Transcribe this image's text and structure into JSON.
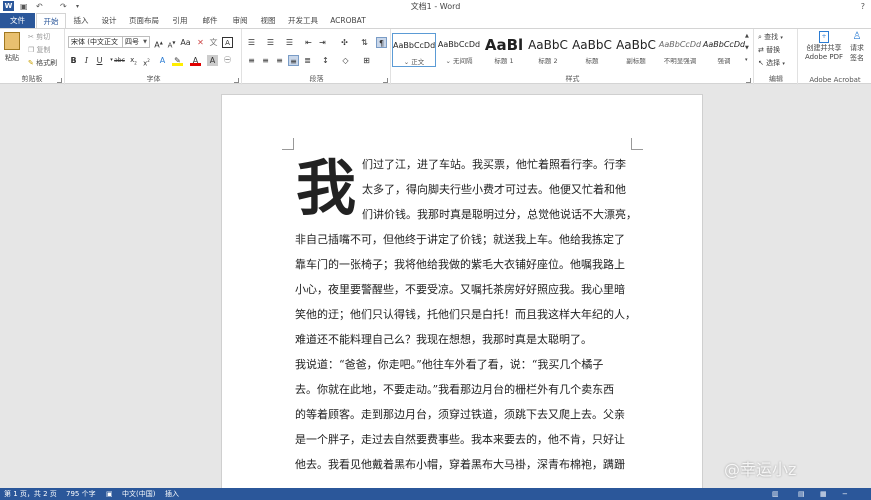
{
  "window": {
    "title": "文档1 - Word",
    "help": "?"
  },
  "quick_access": {
    "undo": "↶",
    "redo": "↷"
  },
  "tabs": [
    "文件",
    "开始",
    "插入",
    "设计",
    "页面布局",
    "引用",
    "邮件",
    "审阅",
    "视图",
    "开发工具",
    "ACROBAT"
  ],
  "clipboard": {
    "paste": "粘贴",
    "cut": "剪切",
    "copy": "复制",
    "format_painter": "格式刷",
    "label": "剪贴板"
  },
  "font": {
    "name": "宋体 (中文正文",
    "size": "四号",
    "label": "字体"
  },
  "paragraph": {
    "label": "段落"
  },
  "styles": {
    "label": "样式",
    "items": [
      {
        "sample": "AaBbCcDd",
        "name": "⌄ 正文"
      },
      {
        "sample": "AaBbCcDd",
        "name": "⌄ 无间隔"
      },
      {
        "sample": "AaBl",
        "name": "标题 1"
      },
      {
        "sample": "AaBbC",
        "name": "标题 2"
      },
      {
        "sample": "AaBbC",
        "name": "标题"
      },
      {
        "sample": "AaBbC",
        "name": "副标题"
      },
      {
        "sample": "AaBbCcDd",
        "name": "不明显强调"
      },
      {
        "sample": "AaBbCcDd",
        "name": "强调"
      }
    ]
  },
  "editing": {
    "find": "查找",
    "replace": "替换",
    "select": "选择",
    "label": "编辑"
  },
  "acrobat": {
    "create_pdf_line1": "创建并共享",
    "create_pdf_line2": "Adobe PDF",
    "request_line1": "请求",
    "request_line2": "签名",
    "label": "Adobe Acrobat"
  },
  "document": {
    "dropcap": "我",
    "lines": [
      "们过了江，进了车站。我买票，他忙着照看行李。行李",
      "太多了，得向脚夫行些小费才可过去。他便又忙着和他",
      "们讲价钱。我那时真是聪明过分，总觉他说话不大漂亮，",
      "非自己插嘴不可，但他终于讲定了价钱；就送我上车。他给我拣定了",
      "靠车门的一张椅子；我将他给我做的紫毛大衣铺好座位。他嘱我路上",
      "小心，夜里要警醒些，不要受凉。又嘱托茶房好好照应我。我心里暗",
      "笑他的迂；他们只认得钱，托他们只是白托！而且我这样大年纪的人，",
      "难道还不能料理自己么？我现在想想，我那时真是太聪明了。",
      "我说道：“爸爸，你走吧。”他往车外看了看，说：“我买几个橘子",
      "去。你就在此地，不要走动。”我看那边月台的栅栏外有几个卖东西",
      "的等着顾客。走到那边月台，须穿过铁道，须跳下去又爬上去。父亲",
      "是一个胖子，走过去自然要费事些。我本来要去的，他不肯，只好让",
      "他去。我看见他戴着黑布小帽，穿着黑布大马褂，深青布棉袍，蹒跚"
    ]
  },
  "status": {
    "page": "第 1 页，共 2 页",
    "words": "795 个字",
    "language": "中文(中国)",
    "mode": "插入"
  },
  "watermark": "@幸运小z",
  "colors": {
    "accent": "#2b579a"
  }
}
